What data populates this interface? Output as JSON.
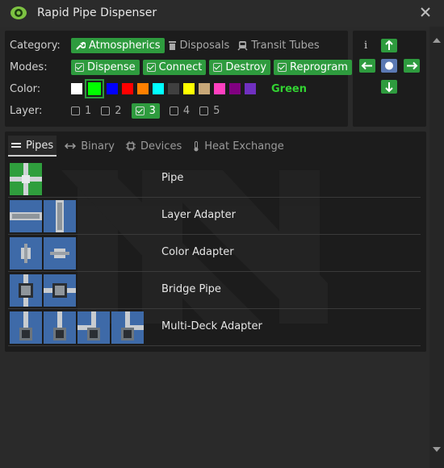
{
  "window": {
    "title": "Rapid Pipe Dispenser",
    "icon": "eye-icon"
  },
  "options": {
    "category": {
      "label": "Category:",
      "items": [
        {
          "label": "Atmospherics",
          "icon": "wrench-icon",
          "selected": true
        },
        {
          "label": "Disposals",
          "icon": "trash-icon",
          "selected": false
        },
        {
          "label": "Transit Tubes",
          "icon": "train-icon",
          "selected": false
        }
      ]
    },
    "modes": {
      "label": "Modes:",
      "items": [
        {
          "label": "Dispense",
          "checked": true
        },
        {
          "label": "Connect",
          "checked": true
        },
        {
          "label": "Destroy",
          "checked": true
        },
        {
          "label": "Reprogram",
          "checked": true
        }
      ]
    },
    "color": {
      "label": "Color:",
      "swatches": [
        "#ffffff",
        "#00ff00",
        "#0000ff",
        "#ff0000",
        "#ff8000",
        "#00ffff",
        "#404040",
        "#ffff00",
        "#c8a878",
        "#ff40c0",
        "#800080",
        "#7030c0"
      ],
      "selected_index": 1,
      "selected_name": "Green"
    },
    "layer": {
      "label": "Layer:",
      "items": [
        {
          "label": "1",
          "checked": false
        },
        {
          "label": "2",
          "checked": false
        },
        {
          "label": "3",
          "checked": true
        },
        {
          "label": "4",
          "checked": false
        },
        {
          "label": "5",
          "checked": false
        }
      ]
    }
  },
  "nav": {
    "info": "i",
    "buttons": [
      "arrow-up-icon",
      "arrow-left-icon",
      "center-dot-icon",
      "arrow-right-icon",
      "arrow-down-icon"
    ]
  },
  "tabs": [
    {
      "label": "Pipes",
      "icon": "pipes-icon",
      "active": true
    },
    {
      "label": "Binary",
      "icon": "double-arrow-icon",
      "active": false
    },
    {
      "label": "Devices",
      "icon": "chip-icon",
      "active": false
    },
    {
      "label": "Heat Exchange",
      "icon": "thermometer-icon",
      "active": false
    }
  ],
  "items": [
    {
      "label": "Pipe",
      "icon_count": 1
    },
    {
      "label": "Layer Adapter",
      "icon_count": 2
    },
    {
      "label": "Color Adapter",
      "icon_count": 2
    },
    {
      "label": "Bridge Pipe",
      "icon_count": 2
    },
    {
      "label": "Multi-Deck Adapter",
      "icon_count": 4
    }
  ],
  "colors": {
    "accent": "#2e9b3e",
    "panel": "#1c1c1c",
    "background": "#2a2a2a",
    "pipe_tile": "#3e6aa8",
    "selected_color_text": "#32d232"
  }
}
